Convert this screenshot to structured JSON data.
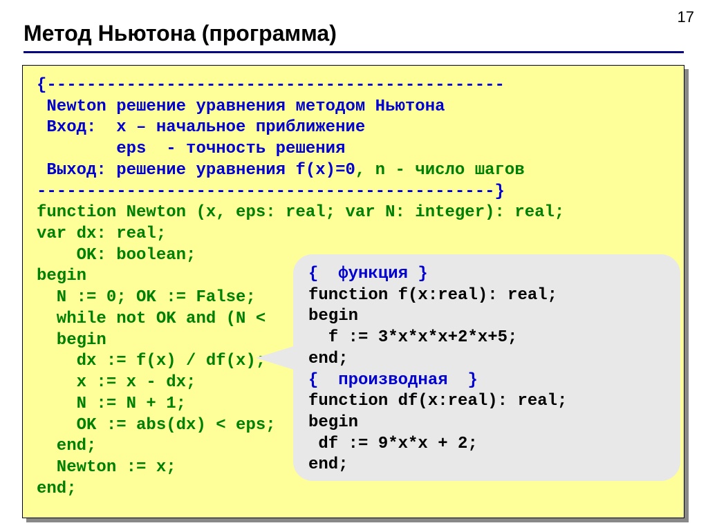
{
  "page_number": "17",
  "title": "Метод Ньютона (программа)",
  "code": {
    "c1": "{----------------------------------------------",
    "c2": " Newton решение уравнения методом Ньютона",
    "c3": " Вход:  x – начальное приближение",
    "c4": "        eps  - точность решения",
    "c5": " Выход: решение уравнения f(x)=0",
    "c5b": ", n - число шагов",
    "c6": "----------------------------------------------}",
    "l1": "function Newton (x, eps: real; var N: integer): real;",
    "l2": "var dx: real;",
    "l3": "    OK: boolean;",
    "l4": "begin",
    "l5": "  N := 0; OK := False;",
    "l6": "  while not OK and (N <",
    "l7": "  begin",
    "l8": "    dx := f(x) / df(x);",
    "l9": "    x := x - dx;",
    "l10": "    N := N + 1;",
    "l11": "    OK := abs(dx) < eps;",
    "l12": "  end;",
    "l13": "  Newton := x;",
    "l14": "end;"
  },
  "callout": {
    "r1a": "{  функция }",
    "r2": "function f(x:real): real;",
    "r3": "begin",
    "r4": "  f := 3*x*x*x+2*x+5;",
    "r5": "end;",
    "r6a": "{  производная  }",
    "r7": "function df(x:real): real;",
    "r8": "begin",
    "r9": " df := 9*x*x + 2;",
    "r10": "end;"
  }
}
